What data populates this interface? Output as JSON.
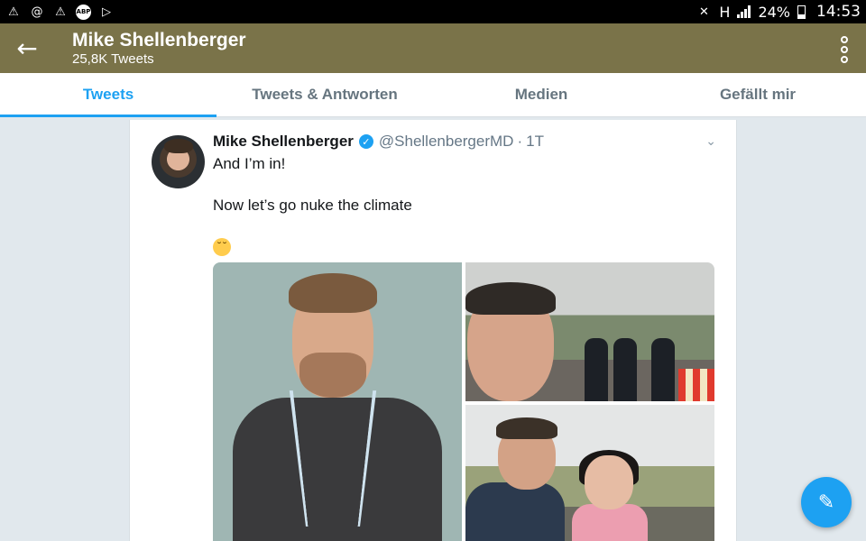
{
  "status_bar": {
    "left_icons": [
      "warning-icon",
      "at-sign-icon",
      "warning-icon",
      "adblock-icon",
      "play-store-icon"
    ],
    "adblock_label": "ABP",
    "network": "H",
    "battery": "24%",
    "time": "14:53"
  },
  "header": {
    "title": "Mike Shellenberger",
    "subtitle": "25,8K Tweets",
    "back_icon": "arrow-left-icon",
    "more_icon": "more-vertical-icon",
    "background": "#7a7349"
  },
  "tabs": [
    {
      "label": "Tweets",
      "active": true
    },
    {
      "label": "Tweets & Antworten",
      "active": false
    },
    {
      "label": "Medien",
      "active": false
    },
    {
      "label": "Gefällt mir",
      "active": false
    }
  ],
  "tweet": {
    "name": "Mike Shellenberger",
    "verified": true,
    "handle": "@ShellenbergerMD",
    "separator": "·",
    "time": "1T",
    "text_lines": [
      "And I’m in!",
      "",
      "Now let’s go nuke the climate",
      ""
    ],
    "emoji": "pensive-face-icon",
    "photos": [
      "portrait-with-lanyard",
      "selfie-with-police",
      "selfie-with-woman"
    ]
  },
  "compose_fab": {
    "icon": "compose-feather-icon"
  },
  "colors": {
    "accent": "#1da1f2",
    "text": "#14171a",
    "muted": "#657786",
    "background": "#e1e8ed"
  }
}
